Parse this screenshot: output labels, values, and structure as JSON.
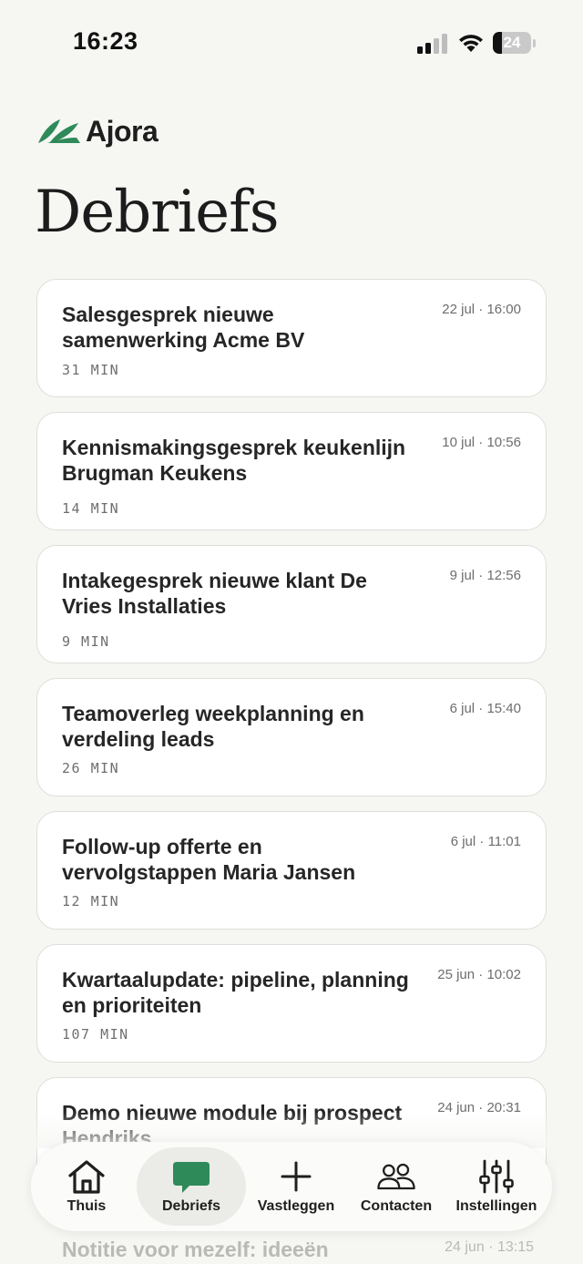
{
  "status_bar": {
    "time": "16:23",
    "battery_level": "24",
    "battery_fraction": 0.24
  },
  "brand": {
    "name": "Ajora",
    "logo_icon": "leaf-logo-icon",
    "accent_color": "#2f8a5a"
  },
  "page": {
    "title": "Debriefs"
  },
  "debriefs": [
    {
      "title": "Salesgesprek nieuwe samenwerking Acme BV",
      "date": "22 jul · 16:00",
      "duration": "31 MIN"
    },
    {
      "title": "Kennismakingsgesprek keukenlijn Brugman Keukens",
      "date": "10 jul · 10:56",
      "duration": "14 MIN"
    },
    {
      "title": "Intakegesprek nieuwe klant De Vries Installaties",
      "date": "9 jul · 12:56",
      "duration": "9 MIN"
    },
    {
      "title": "Teamoverleg weekplanning en verdeling leads",
      "date": "6 jul · 15:40",
      "duration": "26 MIN"
    },
    {
      "title": "Follow-up offerte en vervolgstappen Maria Jansen",
      "date": "6 jul · 11:01",
      "duration": "12 MIN"
    },
    {
      "title": "Kwartaalupdate: pipeline, planning en prioriteiten",
      "date": "25 jun · 10:02",
      "duration": "107 MIN"
    },
    {
      "title": "Demo nieuwe module bij prospect Hendriks",
      "date": "24 jun · 20:31",
      "duration": ""
    }
  ],
  "peek_item": {
    "title": "Notitie voor mezelf: ideeën",
    "date": "24 jun · 13:15"
  },
  "nav": {
    "items": [
      {
        "label": "Thuis",
        "icon": "house-icon"
      },
      {
        "label": "Debriefs",
        "icon": "chat-bubble-icon"
      },
      {
        "label": "Vastleggen",
        "icon": "plus-icon"
      },
      {
        "label": "Contacten",
        "icon": "people-icon"
      },
      {
        "label": "Instellingen",
        "icon": "sliders-icon"
      }
    ],
    "active": "Debriefs"
  }
}
